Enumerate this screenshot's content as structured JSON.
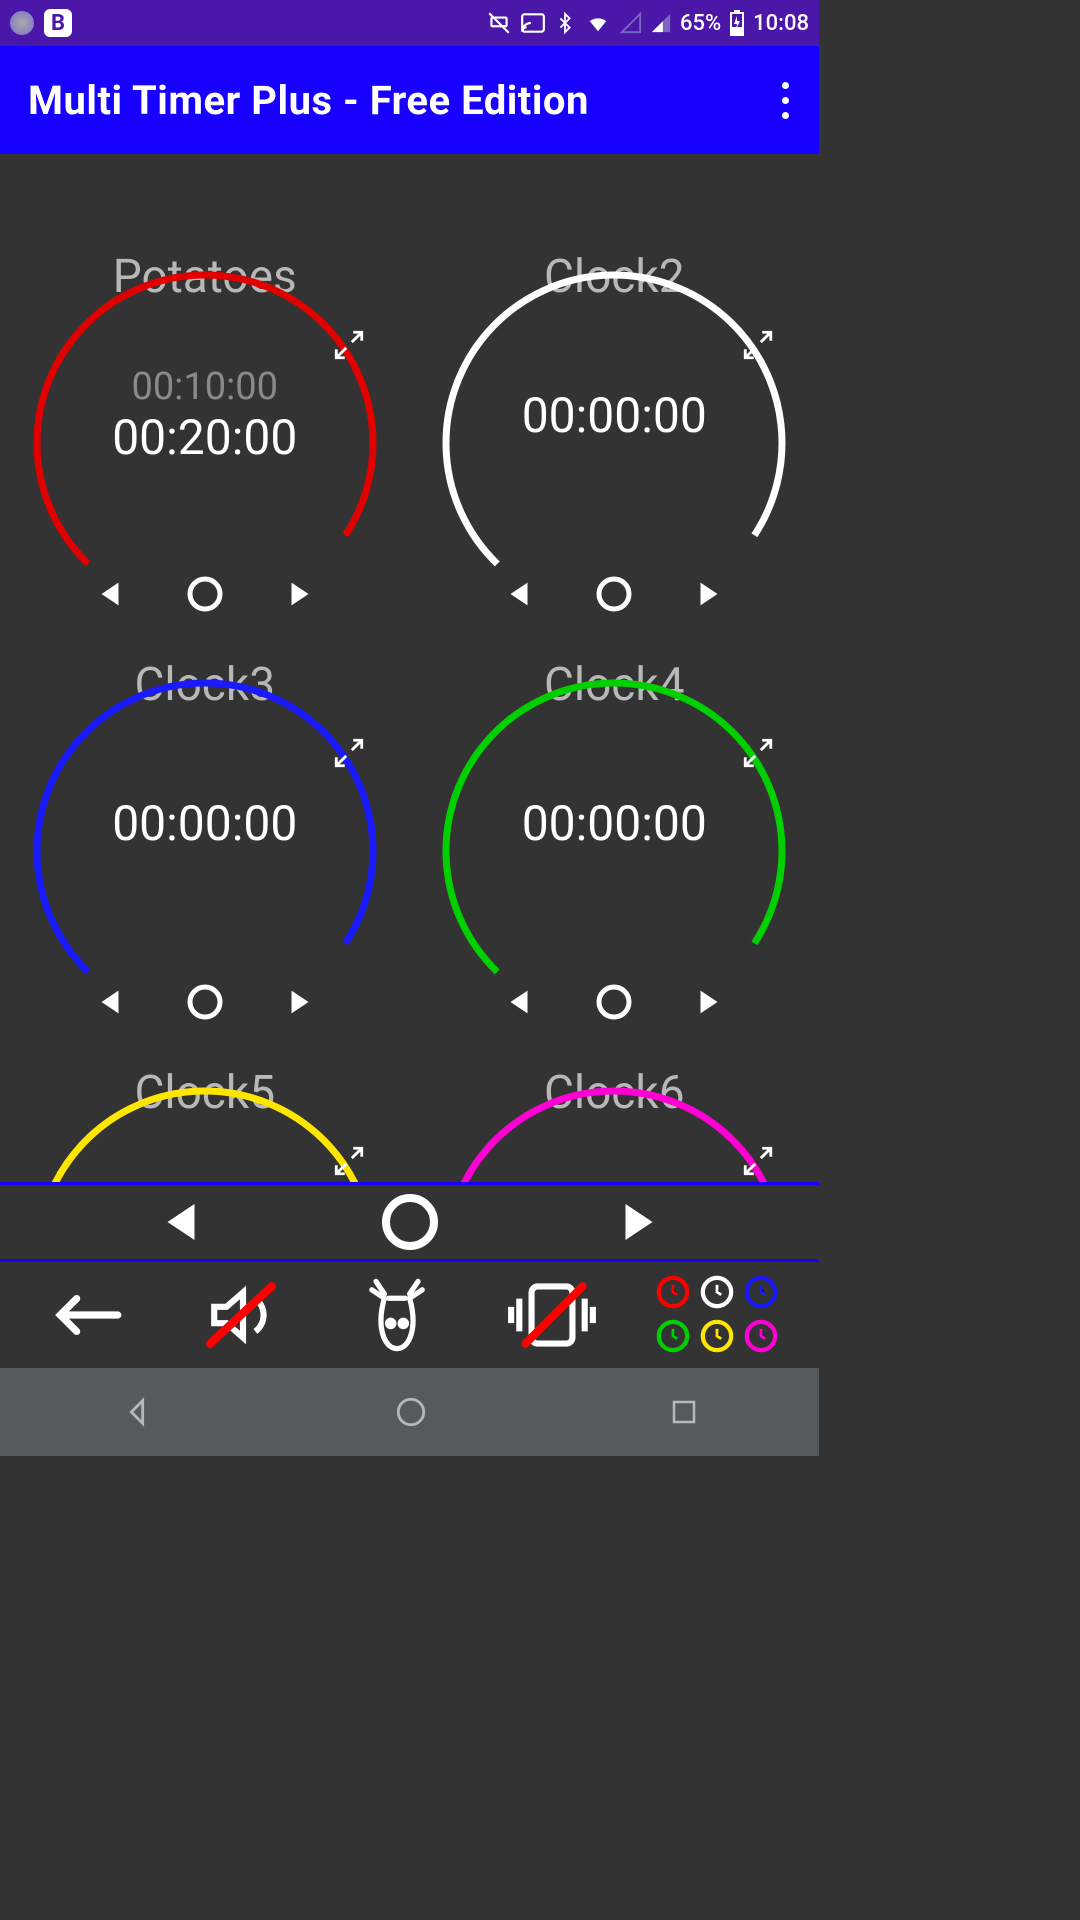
{
  "status": {
    "battery": "65%",
    "time": "10:08"
  },
  "app": {
    "title": "Multi Timer Plus - Free Edition"
  },
  "timers": [
    {
      "name": "Potatoes",
      "sub": "00:10:00",
      "main": "00:20:00",
      "color": "#e00000"
    },
    {
      "name": "Clock2",
      "sub": "",
      "main": "00:00:00",
      "color": "#ffffff"
    },
    {
      "name": "Clock3",
      "sub": "",
      "main": "00:00:00",
      "color": "#1a1aff"
    },
    {
      "name": "Clock4",
      "sub": "",
      "main": "00:00:00",
      "color": "#00d000"
    },
    {
      "name": "Clock5",
      "sub": "",
      "main": "",
      "color": "#ffe600"
    },
    {
      "name": "Clock6",
      "sub": "",
      "main": "",
      "color": "#ff00d4"
    }
  ],
  "mini_clocks": [
    "#ff0000",
    "#ffffff",
    "#1a1aff",
    "#00d000",
    "#ffe600",
    "#ff00d4"
  ]
}
